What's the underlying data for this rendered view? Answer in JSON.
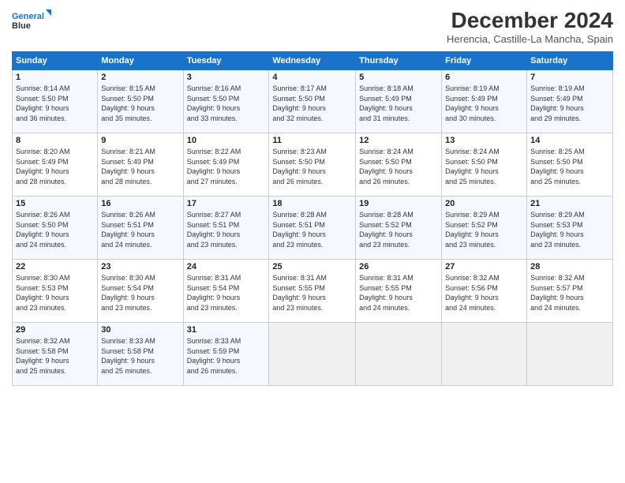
{
  "header": {
    "logo_line1": "General",
    "logo_line2": "Blue",
    "title": "December 2024",
    "subtitle": "Herencia, Castille-La Mancha, Spain"
  },
  "days_of_week": [
    "Sunday",
    "Monday",
    "Tuesday",
    "Wednesday",
    "Thursday",
    "Friday",
    "Saturday"
  ],
  "weeks": [
    [
      {
        "day": 1,
        "info": "Sunrise: 8:14 AM\nSunset: 5:50 PM\nDaylight: 9 hours\nand 36 minutes."
      },
      {
        "day": 2,
        "info": "Sunrise: 8:15 AM\nSunset: 5:50 PM\nDaylight: 9 hours\nand 35 minutes."
      },
      {
        "day": 3,
        "info": "Sunrise: 8:16 AM\nSunset: 5:50 PM\nDaylight: 9 hours\nand 33 minutes."
      },
      {
        "day": 4,
        "info": "Sunrise: 8:17 AM\nSunset: 5:50 PM\nDaylight: 9 hours\nand 32 minutes."
      },
      {
        "day": 5,
        "info": "Sunrise: 8:18 AM\nSunset: 5:49 PM\nDaylight: 9 hours\nand 31 minutes."
      },
      {
        "day": 6,
        "info": "Sunrise: 8:19 AM\nSunset: 5:49 PM\nDaylight: 9 hours\nand 30 minutes."
      },
      {
        "day": 7,
        "info": "Sunrise: 8:19 AM\nSunset: 5:49 PM\nDaylight: 9 hours\nand 29 minutes."
      }
    ],
    [
      {
        "day": 8,
        "info": "Sunrise: 8:20 AM\nSunset: 5:49 PM\nDaylight: 9 hours\nand 28 minutes."
      },
      {
        "day": 9,
        "info": "Sunrise: 8:21 AM\nSunset: 5:49 PM\nDaylight: 9 hours\nand 28 minutes."
      },
      {
        "day": 10,
        "info": "Sunrise: 8:22 AM\nSunset: 5:49 PM\nDaylight: 9 hours\nand 27 minutes."
      },
      {
        "day": 11,
        "info": "Sunrise: 8:23 AM\nSunset: 5:50 PM\nDaylight: 9 hours\nand 26 minutes."
      },
      {
        "day": 12,
        "info": "Sunrise: 8:24 AM\nSunset: 5:50 PM\nDaylight: 9 hours\nand 26 minutes."
      },
      {
        "day": 13,
        "info": "Sunrise: 8:24 AM\nSunset: 5:50 PM\nDaylight: 9 hours\nand 25 minutes."
      },
      {
        "day": 14,
        "info": "Sunrise: 8:25 AM\nSunset: 5:50 PM\nDaylight: 9 hours\nand 25 minutes."
      }
    ],
    [
      {
        "day": 15,
        "info": "Sunrise: 8:26 AM\nSunset: 5:50 PM\nDaylight: 9 hours\nand 24 minutes."
      },
      {
        "day": 16,
        "info": "Sunrise: 8:26 AM\nSunset: 5:51 PM\nDaylight: 9 hours\nand 24 minutes."
      },
      {
        "day": 17,
        "info": "Sunrise: 8:27 AM\nSunset: 5:51 PM\nDaylight: 9 hours\nand 23 minutes."
      },
      {
        "day": 18,
        "info": "Sunrise: 8:28 AM\nSunset: 5:51 PM\nDaylight: 9 hours\nand 23 minutes."
      },
      {
        "day": 19,
        "info": "Sunrise: 8:28 AM\nSunset: 5:52 PM\nDaylight: 9 hours\nand 23 minutes."
      },
      {
        "day": 20,
        "info": "Sunrise: 8:29 AM\nSunset: 5:52 PM\nDaylight: 9 hours\nand 23 minutes."
      },
      {
        "day": 21,
        "info": "Sunrise: 8:29 AM\nSunset: 5:53 PM\nDaylight: 9 hours\nand 23 minutes."
      }
    ],
    [
      {
        "day": 22,
        "info": "Sunrise: 8:30 AM\nSunset: 5:53 PM\nDaylight: 9 hours\nand 23 minutes."
      },
      {
        "day": 23,
        "info": "Sunrise: 8:30 AM\nSunset: 5:54 PM\nDaylight: 9 hours\nand 23 minutes."
      },
      {
        "day": 24,
        "info": "Sunrise: 8:31 AM\nSunset: 5:54 PM\nDaylight: 9 hours\nand 23 minutes."
      },
      {
        "day": 25,
        "info": "Sunrise: 8:31 AM\nSunset: 5:55 PM\nDaylight: 9 hours\nand 23 minutes."
      },
      {
        "day": 26,
        "info": "Sunrise: 8:31 AM\nSunset: 5:55 PM\nDaylight: 9 hours\nand 24 minutes."
      },
      {
        "day": 27,
        "info": "Sunrise: 8:32 AM\nSunset: 5:56 PM\nDaylight: 9 hours\nand 24 minutes."
      },
      {
        "day": 28,
        "info": "Sunrise: 8:32 AM\nSunset: 5:57 PM\nDaylight: 9 hours\nand 24 minutes."
      }
    ],
    [
      {
        "day": 29,
        "info": "Sunrise: 8:32 AM\nSunset: 5:58 PM\nDaylight: 9 hours\nand 25 minutes."
      },
      {
        "day": 30,
        "info": "Sunrise: 8:33 AM\nSunset: 5:58 PM\nDaylight: 9 hours\nand 25 minutes."
      },
      {
        "day": 31,
        "info": "Sunrise: 8:33 AM\nSunset: 5:59 PM\nDaylight: 9 hours\nand 26 minutes."
      },
      null,
      null,
      null,
      null
    ]
  ]
}
